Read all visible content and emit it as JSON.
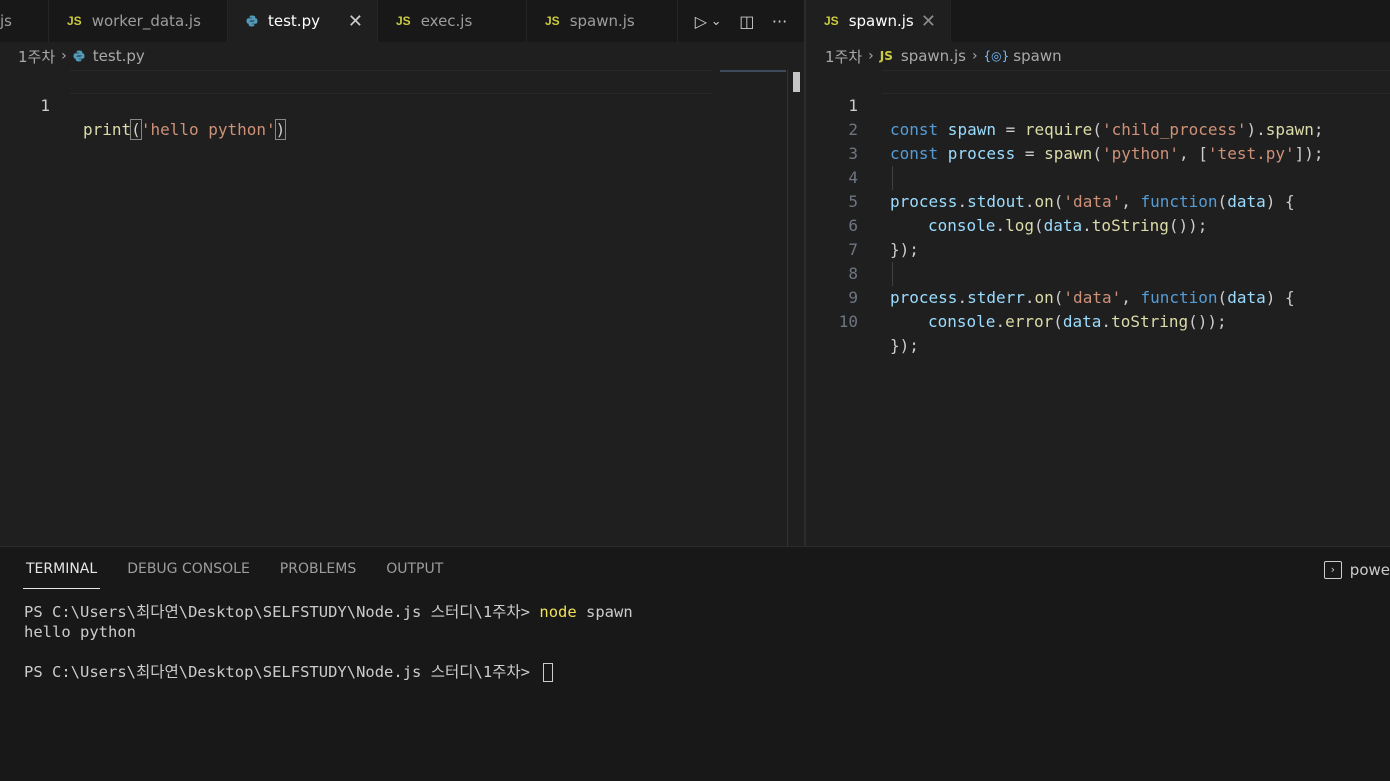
{
  "left_editor": {
    "tabs": [
      {
        "badge": "",
        "label": "js"
      },
      {
        "badge": "JS",
        "label": "worker_data.js"
      },
      {
        "badge": "",
        "label": "test.py",
        "active": true
      },
      {
        "badge": "JS",
        "label": "exec.js"
      },
      {
        "badge": "JS",
        "label": "spawn.js"
      }
    ],
    "close_glyph": "✕",
    "actions": {
      "run": "▷",
      "run_dropdown": "⌄",
      "split": "◫",
      "more": "···"
    },
    "breadcrumb": {
      "folder": "1주차",
      "file": "test.py"
    },
    "code": {
      "line_number": "1",
      "tokens": [
        "print",
        "(",
        "'hello python'",
        ")"
      ]
    }
  },
  "right_editor": {
    "tab": {
      "badge": "JS",
      "label": "spawn.js"
    },
    "close_glyph": "✕",
    "breadcrumb": {
      "folder": "1주차",
      "file_badge": "JS",
      "file": "spawn.js",
      "symbol_icon": "{◎}",
      "symbol": "spawn"
    },
    "line_numbers": [
      "1",
      "2",
      "3",
      "4",
      "5",
      "6",
      "7",
      "8",
      "9",
      "10"
    ],
    "lines": {
      "l1": {
        "kw": "const",
        "name": " spawn",
        "op": " = ",
        "fn": "require",
        "p1": "(",
        "str": "'child_process'",
        "p2": ").",
        "prop": "spawn",
        "end": ";"
      },
      "l2": {
        "kw": "const",
        "name": " process",
        "op": " = ",
        "fn": "spawn",
        "p1": "(",
        "s1": "'python'",
        "p2": ", [",
        "s2": "'test.py'",
        "end": "]);"
      },
      "l4": {
        "obj": "process",
        "d1": ".",
        "prop": "stdout",
        "d2": ".",
        "fn": "on",
        "p1": "(",
        "str": "'data'",
        "c": ", ",
        "kw": "function",
        "p2": "(",
        "arg": "data",
        "end": ") {"
      },
      "l5": {
        "obj": "console",
        "d1": ".",
        "fn": "log",
        "p1": "(",
        "arg": "data",
        "d2": ".",
        "fn2": "toString",
        "end": "());"
      },
      "l6": {
        "text": "});"
      },
      "l8": {
        "obj": "process",
        "d1": ".",
        "prop": "stderr",
        "d2": ".",
        "fn": "on",
        "p1": "(",
        "str": "'data'",
        "c": ", ",
        "kw": "function",
        "p2": "(",
        "arg": "data",
        "end": ") {"
      },
      "l9": {
        "obj": "console",
        "d1": ".",
        "fn": "error",
        "p1": "(",
        "arg": "data",
        "d2": ".",
        "fn2": "toString",
        "end": "());"
      },
      "l10": {
        "text": "});"
      }
    }
  },
  "panel": {
    "tabs": [
      "TERMINAL",
      "DEBUG CONSOLE",
      "PROBLEMS",
      "OUTPUT"
    ],
    "terminal_label": "powe",
    "terminal_icon": "›",
    "lines": {
      "prompt1": "PS C:\\Users\\최다연\\Desktop\\SELFSTUDY\\Node.js 스터디\\1주차> ",
      "cmd1": "node",
      "arg1": " spawn",
      "output1": "hello python",
      "prompt2": "PS C:\\Users\\최다연\\Desktop\\SELFSTUDY\\Node.js 스터디\\1주차> "
    }
  },
  "colors": {
    "background": "#1f1f1f",
    "keyword": "#569cd6",
    "function": "#dcdcaa",
    "string": "#ce9178",
    "variable": "#9cdcfe",
    "js_badge": "#cbcb41",
    "python_icon": "#519aba"
  }
}
